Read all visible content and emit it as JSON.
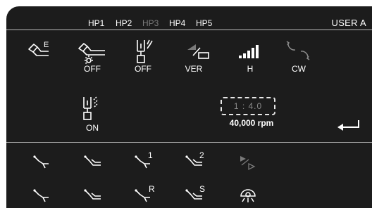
{
  "header": {
    "hp_tabs": [
      {
        "label": "HP1",
        "active": true
      },
      {
        "label": "HP2",
        "active": true
      },
      {
        "label": "HP3",
        "active": false
      },
      {
        "label": "HP4",
        "active": true
      },
      {
        "label": "HP5",
        "active": true
      }
    ],
    "user": "USER A"
  },
  "settings": {
    "handpiece_mode": "E",
    "light": "OFF",
    "spray": "OFF",
    "torque": "VER",
    "speed_level": "H",
    "direction": "CW",
    "water": "ON"
  },
  "speed": {
    "ratio": "1 : 4.0",
    "rpm": "40,000 rpm"
  },
  "presets": {
    "row1_marks": [
      "",
      "",
      "1",
      "2",
      ""
    ],
    "row2_marks": [
      "",
      "",
      "R",
      "S",
      ""
    ]
  },
  "colors": {
    "background": "#1c1c1c",
    "text": "#ffffff",
    "disabled": "#7a7a7a",
    "divider": "#bdbdbd"
  }
}
